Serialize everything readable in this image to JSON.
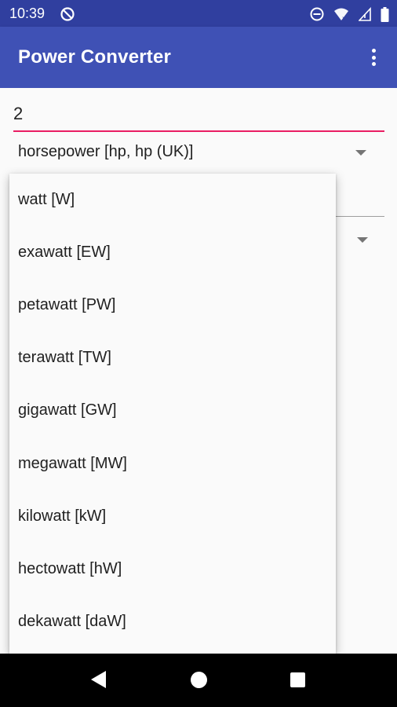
{
  "status_bar": {
    "time": "10:39",
    "icons": [
      "sync-disabled-icon",
      "do-not-disturb-icon",
      "wifi-icon",
      "cell-signal-icon",
      "battery-icon"
    ]
  },
  "app_bar": {
    "title": "Power Converter",
    "menu_icon": "overflow-menu-icon"
  },
  "input": {
    "value": "2"
  },
  "from_unit": {
    "selected": "horsepower [hp, hp (UK)]"
  },
  "dropdown": {
    "items": [
      "watt [W]",
      "exawatt [EW]",
      "petawatt [PW]",
      "terawatt [TW]",
      "gigawatt [GW]",
      "megawatt [MW]",
      "kilowatt [kW]",
      "hectowatt [hW]",
      "dekawatt [daW]"
    ]
  },
  "nav_bar": {
    "icons": [
      "back-icon",
      "home-icon",
      "recents-icon"
    ]
  },
  "colors": {
    "status_bar": "#303f9f",
    "app_bar": "#3f51b5",
    "accent": "#e91e63",
    "background": "#fafafa"
  }
}
